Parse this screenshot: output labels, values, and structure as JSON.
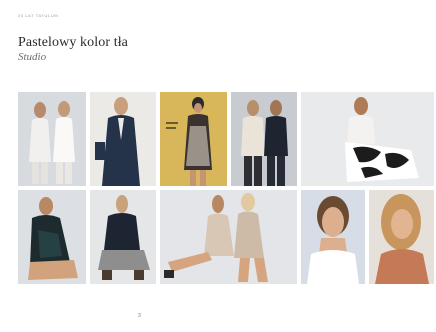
{
  "header": {
    "label": "20 LAT TATULUM"
  },
  "title": "Pastelowy kolor tła",
  "subtitle": "Studio",
  "page_number": "3",
  "photos": [
    {
      "name": "photo-two-models-white-outfits",
      "bg": "#d7dbe0"
    },
    {
      "name": "photo-model-navy-blazer",
      "bg": "#eceae7"
    },
    {
      "name": "photo-magazine-cover-yellow",
      "bg": "#d8b75a"
    },
    {
      "name": "photo-two-models-light-and-dark",
      "bg": "#c8cbd0"
    },
    {
      "name": "photo-model-black-white-skirt",
      "bg": "#e9eaec"
    },
    {
      "name": "photo-model-dark-dress-seated",
      "bg": "#dcdfe3"
    },
    {
      "name": "photo-model-dark-sweater-seated",
      "bg": "#e5e6e8"
    },
    {
      "name": "photo-two-models-seated-dresses",
      "bg": "#e4e5e8"
    },
    {
      "name": "photo-model-portrait-white-top",
      "bg": "#d6dde6"
    },
    {
      "name": "photo-model-portrait-smiling",
      "bg": "#e6e0da"
    }
  ]
}
